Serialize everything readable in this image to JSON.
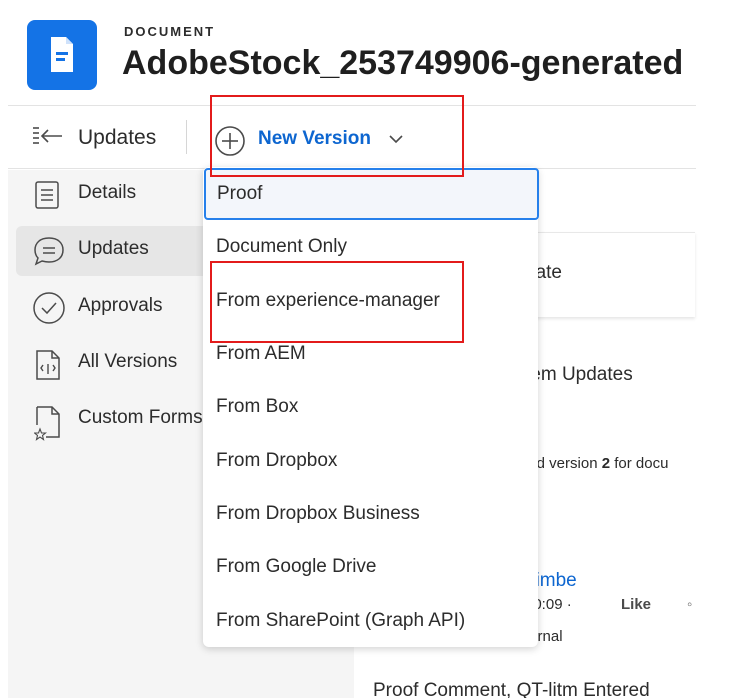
{
  "header": {
    "kicker": "DOCUMENT",
    "title": "AdobeStock_253749906-generated"
  },
  "toolbar": {
    "panel_label": "Updates",
    "new_version_label": "New Version"
  },
  "sidebar": {
    "items": [
      {
        "label": "Details",
        "icon": "document-lines-icon"
      },
      {
        "label": "Updates",
        "icon": "chat-bubble-icon",
        "active": true
      },
      {
        "label": "Approvals",
        "icon": "checkmark-circle-icon"
      },
      {
        "label": "All Versions",
        "icon": "versions-icon"
      },
      {
        "label": "Custom Forms",
        "icon": "custom-form-icon"
      }
    ]
  },
  "main": {
    "card_text": "date",
    "section_text": "tem Updates",
    "activity_text_pre": "led version ",
    "activity_text_num": "2",
    "activity_text_post": " for docu",
    "user_link": "gimbe",
    "time": "20:09 ·",
    "like_label": "Like",
    "bullet": "◦",
    "visibility": "ternal",
    "bottom_text": "Proof Comment, QT-litm Entered"
  },
  "dropdown": {
    "items": [
      "Proof",
      "Document Only",
      "From experience-manager",
      "From AEM",
      "From Box",
      "From Dropbox",
      "From Dropbox Business",
      "From Google Drive",
      "From SharePoint (Graph API)"
    ],
    "selected_index": 0
  },
  "colors": {
    "brand_blue": "#1473e6",
    "link_blue": "#0d66d0",
    "annotation_red": "#e31b1b",
    "focus_blue": "#2680eb"
  }
}
